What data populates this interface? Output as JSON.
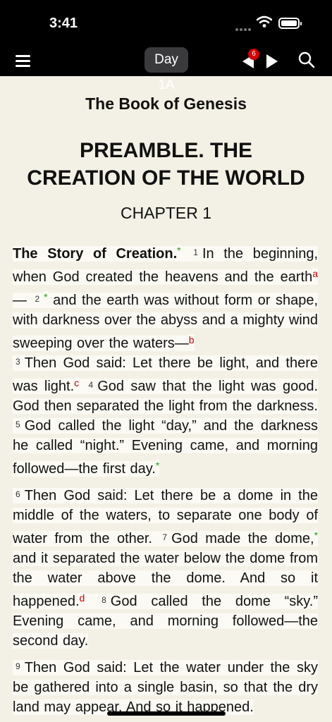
{
  "status": {
    "time": "3:41",
    "battery_level": 1.0
  },
  "toolbar": {
    "day_label": "Day 1A",
    "badge_count": "6"
  },
  "book": {
    "title": "The Book of Genesis",
    "section_line1": "PREAMBLE. THE",
    "section_line2": "CREATION OF THE WORLD",
    "chapter": "CHAPTER 1"
  },
  "para1": {
    "heading": "The Story of Creation.",
    "star": "*",
    "v1": "1",
    "t1": "In the beginning, when God created the heavens and the earth",
    "fa": "a",
    "dash": "—",
    "v2": "2",
    "t2": "and the earth was without form or shape, with darkness over the abyss and a mighty wind sweeping over the waters—",
    "fb": "b"
  },
  "para2": {
    "v3": "3",
    "t3": "Then God said: Let there be light, and there was light.",
    "fc": "c",
    "v4": "4",
    "t4": "God saw that the light was good. God then separated the light from the darkness.",
    "v5": "5",
    "t5": "God called the light “day,” and the darkness he called “night.” Evening came, and morning followed—the first day.",
    "star": "*"
  },
  "para3": {
    "v6": "6",
    "t6": "Then God said: Let there be a dome in the middle of the waters, to separate one body of water from the other.",
    "v7": "7",
    "t7a": "God made the dome,",
    "star": "*",
    "t7b": "and it separated the water below the dome from the water above the dome. And so it happened.",
    "fd": "d",
    "v8": "8",
    "t8": "God called the dome “sky.” Evening came, and morning followed—the second day."
  },
  "para4": {
    "v9": "9",
    "t9": "Then God said: Let the water under the sky be gathered into a single basin, so that the dry land may appear. And so it happened."
  }
}
